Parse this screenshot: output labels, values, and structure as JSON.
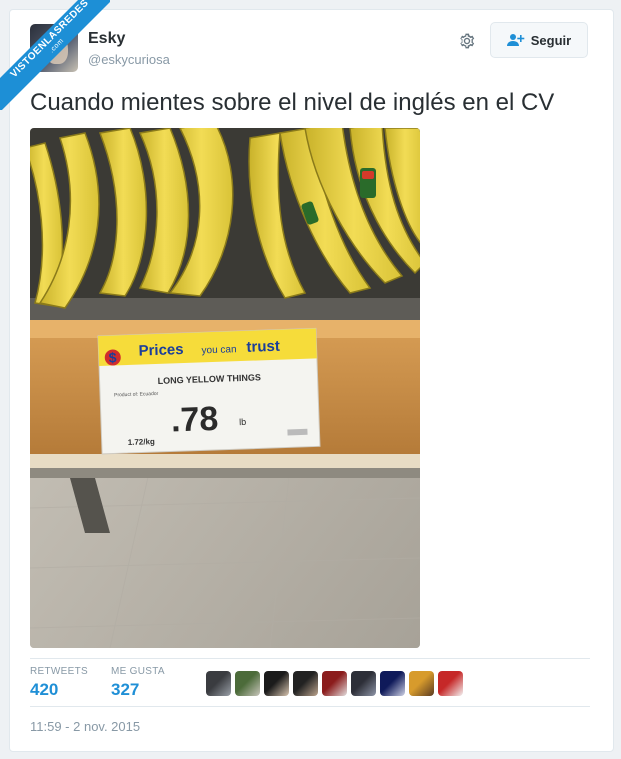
{
  "watermark": {
    "line1": "VISTOENLASREDES",
    "line2": ".com"
  },
  "tweet": {
    "author_name": "Esky",
    "author_handle": "@eskycuriosa",
    "follow_label": "Seguir",
    "text": "Cuando mientes sobre el nivel de inglés en el CV",
    "timestamp": "11:59 - 2 nov. 2015"
  },
  "photo_sign": {
    "headline_prices": "Prices",
    "headline_you_can": "you can",
    "headline_trust": "trust",
    "product": "LONG YELLOW THINGS",
    "origin": "Product of: Ecuador",
    "price": ".78",
    "unit": "lb",
    "per_kg": "1.72/kg"
  },
  "stats": {
    "retweets_label": "RETWEETS",
    "retweets_value": "420",
    "likes_label": "ME GUSTA",
    "likes_value": "327"
  },
  "liker_avatars": [
    {
      "colors": [
        "#3a3c40",
        "#9aa0a8"
      ]
    },
    {
      "colors": [
        "#4c6b3a",
        "#c9c6bc"
      ]
    },
    {
      "colors": [
        "#1b1b1b",
        "#d9c6b1"
      ]
    },
    {
      "colors": [
        "#222",
        "#bca48e"
      ]
    },
    {
      "colors": [
        "#8b1c1c",
        "#e3dede"
      ]
    },
    {
      "colors": [
        "#2d2f38",
        "#8f96a8"
      ]
    },
    {
      "colors": [
        "#0f1a5a",
        "#d0d3e6"
      ]
    },
    {
      "colors": [
        "#d79b2c",
        "#5a3a22"
      ]
    },
    {
      "colors": [
        "#c62828",
        "#f3f3f3"
      ]
    }
  ]
}
